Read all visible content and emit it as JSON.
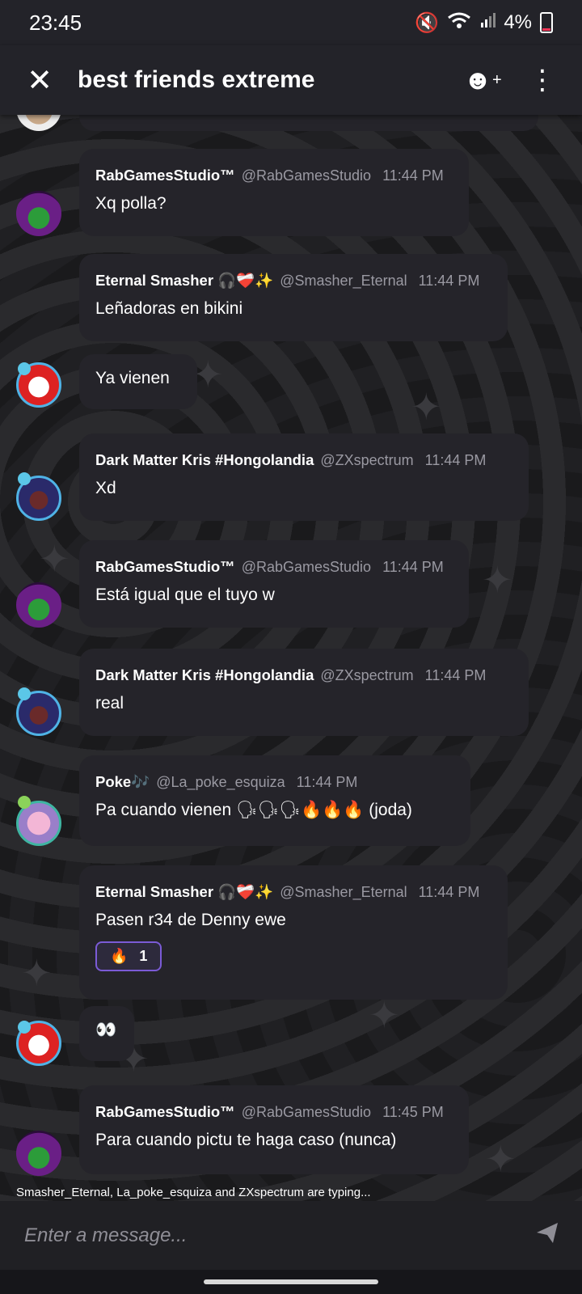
{
  "status_bar": {
    "time": "23:45",
    "battery": "4%"
  },
  "header": {
    "title": "best friends extreme"
  },
  "messages": [
    {
      "author": "RabGamesStudio™",
      "handle": "@RabGamesStudio",
      "time": "11:44 PM",
      "text": "Xq polla?"
    },
    {
      "author": "Eternal Smasher 🎧❤️‍🩹✨",
      "handle": "@Smasher_Eternal",
      "time": "11:44 PM",
      "text": "Leñadoras en bikini"
    },
    {
      "text": "Ya vienen"
    },
    {
      "author": "Dark Matter Kris #Hongolandia",
      "handle": "@ZXspectrum",
      "time": "11:44 PM",
      "text": "Xd"
    },
    {
      "author": "RabGamesStudio™",
      "handle": "@RabGamesStudio",
      "time": "11:44 PM",
      "text": "Está igual que el tuyo w"
    },
    {
      "author": "Dark Matter Kris #Hongolandia",
      "handle": "@ZXspectrum",
      "time": "11:44 PM",
      "text": "real"
    },
    {
      "author": "Poke🎶",
      "handle": "@La_poke_esquiza",
      "time": "11:44 PM",
      "text": "Pa cuando vienen 🗣🗣🗣🔥🔥🔥 (joda)"
    },
    {
      "author": "Eternal Smasher 🎧❤️‍🩹✨",
      "handle": "@Smasher_Eternal",
      "time": "11:44 PM",
      "text": "Pasen r34 de Denny ewe",
      "reaction": {
        "emoji": "🔥",
        "count": "1"
      }
    },
    {
      "text": "👀"
    },
    {
      "author": "RabGamesStudio™",
      "handle": "@RabGamesStudio",
      "time": "11:45 PM",
      "text": "Para cuando pictu te haga caso (nunca)"
    }
  ],
  "typing_indicator": "Smasher_Eternal, La_poke_esquiza and ZXspectrum are typing...",
  "composer": {
    "placeholder": "Enter a message..."
  },
  "icons": {
    "close": "close-icon",
    "add_member": "add-member-icon",
    "more": "more-vertical-icon",
    "send": "send-icon"
  }
}
